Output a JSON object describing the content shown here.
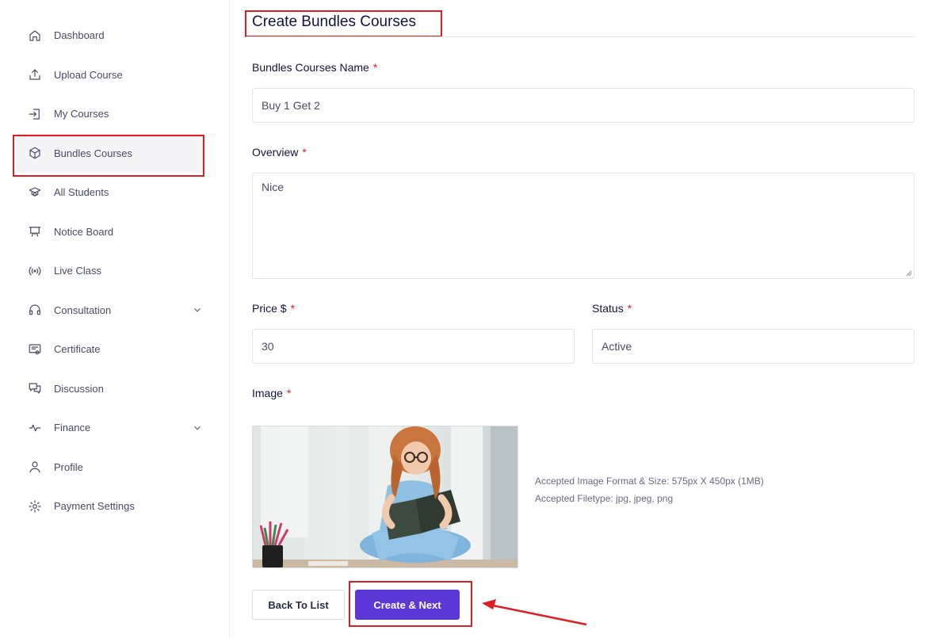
{
  "sidebar": {
    "items": [
      {
        "label": "Dashboard",
        "icon": "home-icon"
      },
      {
        "label": "Upload Course",
        "icon": "upload-icon"
      },
      {
        "label": "My Courses",
        "icon": "login-icon"
      },
      {
        "label": "Bundles Courses",
        "icon": "box-icon",
        "active": true
      },
      {
        "label": "All Students",
        "icon": "graduation-icon"
      },
      {
        "label": "Notice Board",
        "icon": "presentation-board-icon"
      },
      {
        "label": "Live Class",
        "icon": "broadcast-icon"
      },
      {
        "label": "Consultation",
        "icon": "headset-icon",
        "expandable": true
      },
      {
        "label": "Certificate",
        "icon": "certificate-icon"
      },
      {
        "label": "Discussion",
        "icon": "chat-icon"
      },
      {
        "label": "Finance",
        "icon": "pulse-icon",
        "expandable": true
      },
      {
        "label": "Profile",
        "icon": "user-icon"
      },
      {
        "label": "Payment Settings",
        "icon": "gear-icon"
      }
    ]
  },
  "page": {
    "title": "Create Bundles Courses"
  },
  "form": {
    "name_label": "Bundles Courses Name",
    "name_value": "Buy 1 Get 2",
    "overview_label": "Overview",
    "overview_value": "Nice",
    "price_label": "Price $",
    "price_value": "30",
    "status_label": "Status",
    "status_value": "Active",
    "image_label": "Image",
    "required_mark": "*",
    "image_hint_1": "Accepted Image Format & Size: 575px X 450px (1MB)",
    "image_hint_2": "Accepted Filetype: jpg, jpeg, png"
  },
  "actions": {
    "back_label": "Back To List",
    "create_label": "Create & Next"
  },
  "colors": {
    "primary": "#5d38d8",
    "highlight": "#e01b24",
    "required": "#e01b24"
  }
}
